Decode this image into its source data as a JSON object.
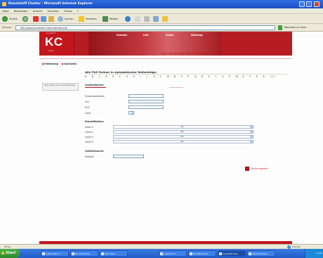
{
  "window": {
    "title": "Kunststoff Cluster - Microsoft Internet Explorer"
  },
  "menubar": [
    "Datei",
    "Bearbeiten",
    "Ansicht",
    "Favoriten",
    "Extras",
    "?"
  ],
  "toolbar": {
    "back_label": "Zurück",
    "search_label": "Suchen",
    "favorites_label": "Favoriten",
    "media_label": "Medien"
  },
  "address": {
    "label": "Adresse",
    "url": "http://www.kunststoff-cluster.at/index.php",
    "links_label": "Wechseln zu Links"
  },
  "site": {
    "logo_big": "KC",
    "logo_small": "kunststoff",
    "logo_under": "cluster",
    "nav": [
      "Kontakt",
      "Info",
      "Suche",
      "Wartung"
    ],
    "tagline": "F&E RESSOURCEN-PLATTFORM FÜR DIE KUNSTSTOFFBRANCHE"
  },
  "sidebar": {
    "links": [
      "Hilfetextop",
      "Startseite"
    ],
    "banner": "Hier geht's zur Kunststoffmesse"
  },
  "main": {
    "heading": "Alle F&E Partner in alphabetischer Reihenfolge:",
    "letters": [
      "A",
      "B",
      "C",
      "D",
      "E",
      "F",
      "G",
      "H",
      "I",
      "J",
      "K",
      "L",
      "M",
      "N",
      "O",
      "P",
      "Q",
      "R",
      "S",
      "T",
      "U",
      "V",
      "W",
      "X",
      "Y",
      "Z",
      "Ä"
    ],
    "letters_extra": "ALLE",
    "section_search": "Suchkriterien:",
    "labels": {
      "firma": "Firmenname/Inst.:",
      "ort": "Ort:",
      "plz": "PLZ:",
      "land": "Land:"
    },
    "section_class": "Klassifikation:",
    "levels": [
      {
        "label": "Level 1:",
        "value": "alle"
      },
      {
        "label": "Level 2:",
        "value": "alle"
      },
      {
        "label": "Level 3:",
        "value": "alle"
      },
      {
        "label": "Level 4:",
        "value": "alle"
      }
    ],
    "section_fulltext": "Volltextsuche:",
    "produkt_label": "Produkt:",
    "search_button": "Suche starten"
  },
  "statusbar": {
    "left": "Fertig",
    "right": "Internet"
  },
  "taskbar": {
    "start": "Start",
    "tasks": [
      "3 Microsoft O...",
      "Microsoft Excel",
      "Paint Shop",
      "2 Adobe Acr...",
      "Kunststoff Clus...",
      "Kunststoff Clus...",
      "Adobe Photosh..."
    ],
    "clock": "11:48"
  }
}
